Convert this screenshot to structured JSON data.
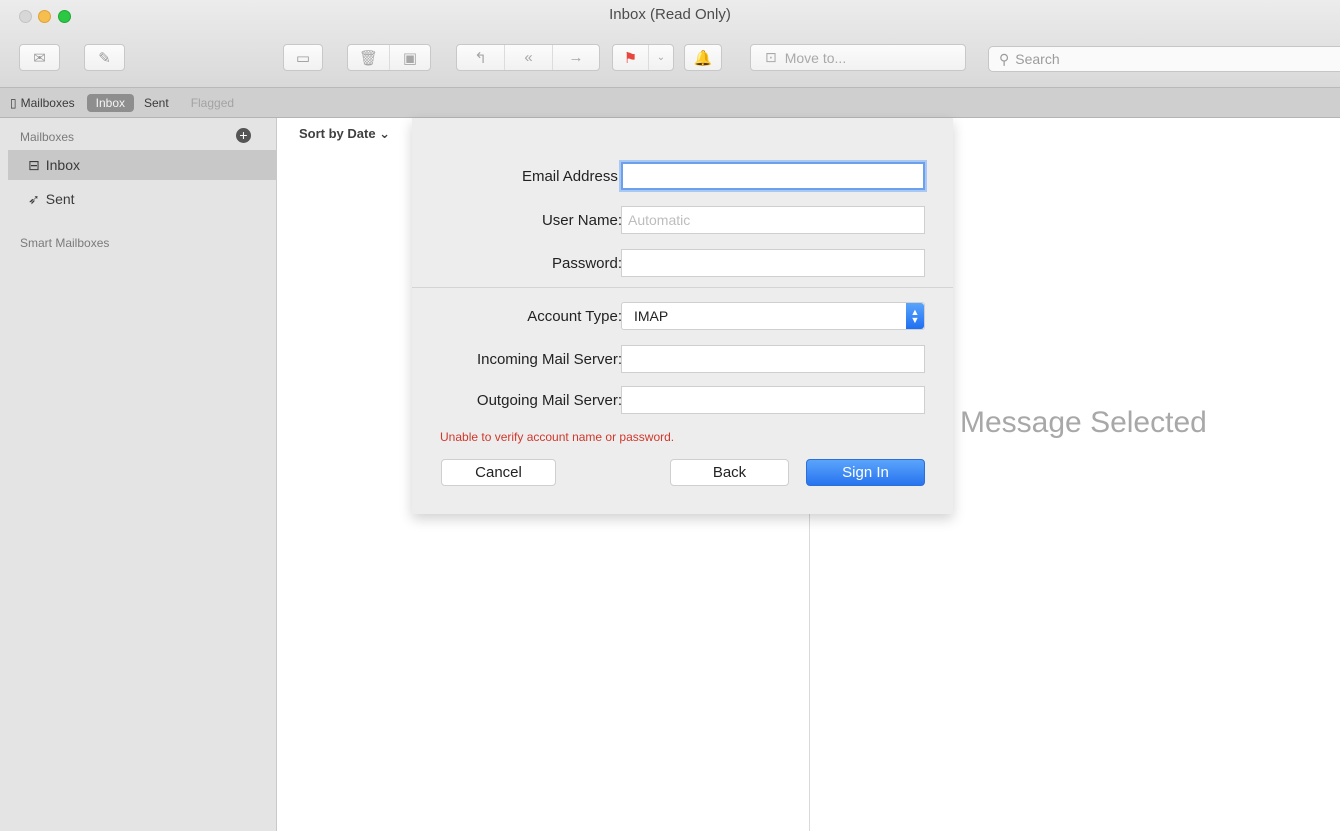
{
  "window": {
    "title": "Inbox (Read Only)"
  },
  "toolbar": {
    "get_mail_icon": "envelope-icon",
    "compose_icon": "compose-icon",
    "move_to_label": "Move to...",
    "search_placeholder": "Search"
  },
  "favorites": {
    "mailboxes_label": "Mailboxes",
    "inbox_label": "Inbox",
    "sent_label": "Sent",
    "flagged_label": "Flagged"
  },
  "sidebar": {
    "header": "Mailboxes",
    "items": [
      {
        "label": "Inbox",
        "icon": "inbox-tray-icon",
        "selected": true
      },
      {
        "label": "Sent",
        "icon": "paper-plane-icon",
        "selected": false
      }
    ],
    "smart_header": "Smart Mailboxes"
  },
  "list": {
    "sort_label": "Sort by Date ⌄"
  },
  "viewer": {
    "empty_text": "Message Selected"
  },
  "sheet": {
    "email_label": "Email Address:",
    "email_value": "",
    "username_label": "User Name:",
    "username_placeholder": "Automatic",
    "password_label": "Password:",
    "account_type_label": "Account Type:",
    "account_type_value": "IMAP",
    "incoming_label": "Incoming Mail Server:",
    "outgoing_label": "Outgoing Mail Server:",
    "error_text": "Unable to verify account name or password.",
    "cancel_label": "Cancel",
    "back_label": "Back",
    "signin_label": "Sign In"
  },
  "colors": {
    "accent": "#2874ef",
    "error": "#d0382c",
    "flag": "#e8453c"
  }
}
